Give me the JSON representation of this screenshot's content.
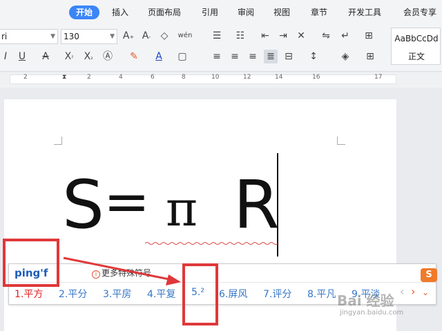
{
  "menu": {
    "tabs": [
      {
        "label": "开始"
      },
      {
        "label": "插入"
      },
      {
        "label": "页面布局"
      },
      {
        "label": "引用"
      },
      {
        "label": "审阅"
      },
      {
        "label": "视图"
      },
      {
        "label": "章节"
      },
      {
        "label": "开发工具"
      },
      {
        "label": "会员专享"
      }
    ]
  },
  "ribbon": {
    "font_name": "ri",
    "font_size": "130",
    "style_sample": "AaBbCcDd",
    "style_name": "正文",
    "phonetic_glyph": "wén"
  },
  "ruler": {
    "numbers": [
      "2",
      "2",
      "4",
      "6",
      "8",
      "10",
      "12",
      "14",
      "16",
      "17"
    ]
  },
  "document": {
    "formula": {
      "s": "S",
      "eq": "=",
      "pi": "π",
      "r": "R"
    }
  },
  "ime": {
    "input": "ping'f",
    "hint": "更多特殊符号",
    "logo": "S",
    "candidates": [
      {
        "label": "1.平方"
      },
      {
        "label": "2.平分"
      },
      {
        "label": "3.平房"
      },
      {
        "label": "4.平复"
      },
      {
        "label": "5.²"
      },
      {
        "label": "6.屏风"
      },
      {
        "label": "7.评分"
      },
      {
        "label": "8.平凡"
      },
      {
        "label": "9.平淡"
      }
    ],
    "prev": "‹",
    "next": "›"
  },
  "watermark": {
    "main": "Bai 经验",
    "sub": "jingyan.baidu.com"
  },
  "colors": {
    "accent": "#3a85f8",
    "annotation": "#e0383a",
    "candidate_first": "#e02020",
    "candidate": "#3577c6"
  }
}
